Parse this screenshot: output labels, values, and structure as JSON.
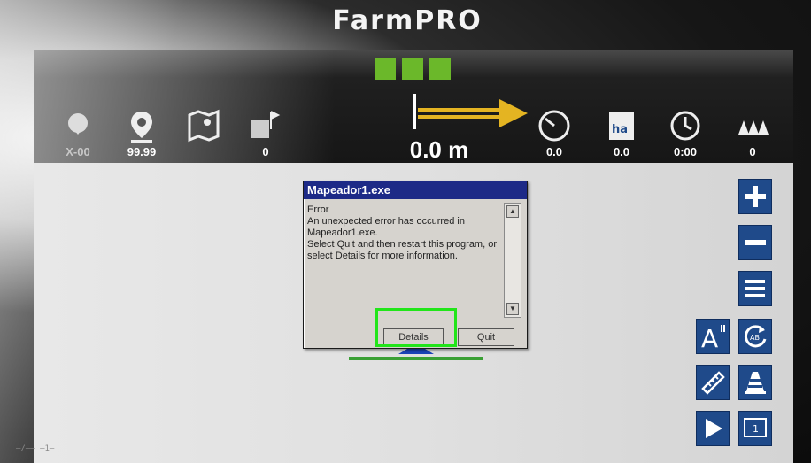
{
  "device": {
    "brand": "FarmPRO"
  },
  "statusbar": {
    "lights": [
      "green",
      "green",
      "green"
    ],
    "accent_color": "#6bb82a",
    "items": [
      {
        "icon": "gps-signal-icon",
        "value": "X-00"
      },
      {
        "icon": "location-pin-icon",
        "value": "99.99"
      },
      {
        "icon": "map-icon",
        "value": ""
      },
      {
        "icon": "field-flags-icon",
        "value": "0"
      },
      {
        "icon": "speedometer-icon",
        "value": "0.0"
      },
      {
        "icon": "hectare-icon",
        "value": "0.0",
        "label": "ha"
      },
      {
        "icon": "clock-icon",
        "value": "0:00"
      },
      {
        "icon": "nozzles-icon",
        "value": "0"
      }
    ],
    "distance": "0.0 m"
  },
  "dialog": {
    "title": "Mapeador1.exe",
    "message": "Error\nAn unexpected error has occurred in Mapeador1.exe.\nSelect Quit and then restart this program, or select Details for more information.",
    "details_label": "Details",
    "quit_label": "Quit"
  },
  "sidebar": {
    "buttons": [
      {
        "name": "zoom-in-button",
        "icon": "plus-icon"
      },
      {
        "name": "zoom-out-button",
        "icon": "minus-icon"
      },
      {
        "name": "menu-button",
        "icon": "menu-icon"
      },
      {
        "name": "font-size-button",
        "icon": "font-size-icon",
        "label": "A"
      },
      {
        "name": "rotate-ab-button",
        "icon": "rotate-ab-icon",
        "label": "AB"
      },
      {
        "name": "ruler-button",
        "icon": "ruler-icon"
      },
      {
        "name": "cone-button",
        "icon": "cone-icon"
      },
      {
        "name": "play-button",
        "icon": "play-icon"
      },
      {
        "name": "screen-one-button",
        "icon": "screen-one-icon",
        "label": "1"
      }
    ],
    "button_color": "#1f4a8a"
  },
  "footer": {
    "text": "—/—— —1—"
  }
}
